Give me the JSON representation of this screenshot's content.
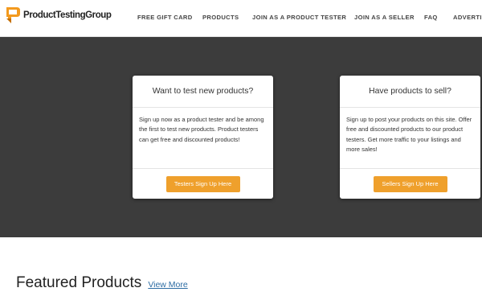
{
  "header": {
    "logo": {
      "text": "ProductTestingGroup",
      "icon": "ptg-logo-icon"
    },
    "nav": [
      {
        "label": "FREE GIFT CARD"
      },
      {
        "label": "PRODUCTS"
      },
      {
        "label": "JOIN AS A PRODUCT TESTER"
      },
      {
        "label": "JOIN AS A SELLER"
      },
      {
        "label": "FAQ"
      },
      {
        "label": "ADVERTIS"
      }
    ]
  },
  "hero": {
    "tester_card": {
      "title": "Want to test new products?",
      "body": "Sign up now as a product tester and be among the first to test new products. Product testers can get free and discounted products!",
      "button": "Testers Sign Up Here"
    },
    "seller_card": {
      "title": "Have products to sell?",
      "body": "Sign up to post your products on this site. Offer free and discounted products to our product testers. Get more traffic to your listings and more sales!",
      "button": "Sellers Sign Up Here"
    }
  },
  "featured": {
    "title": "Featured Products",
    "view_more": "View More"
  },
  "colors": {
    "hero_background": "#3c3c3c",
    "button": "#efa02c",
    "link": "#2e6da4",
    "logo_orange": "#f39a1e"
  }
}
